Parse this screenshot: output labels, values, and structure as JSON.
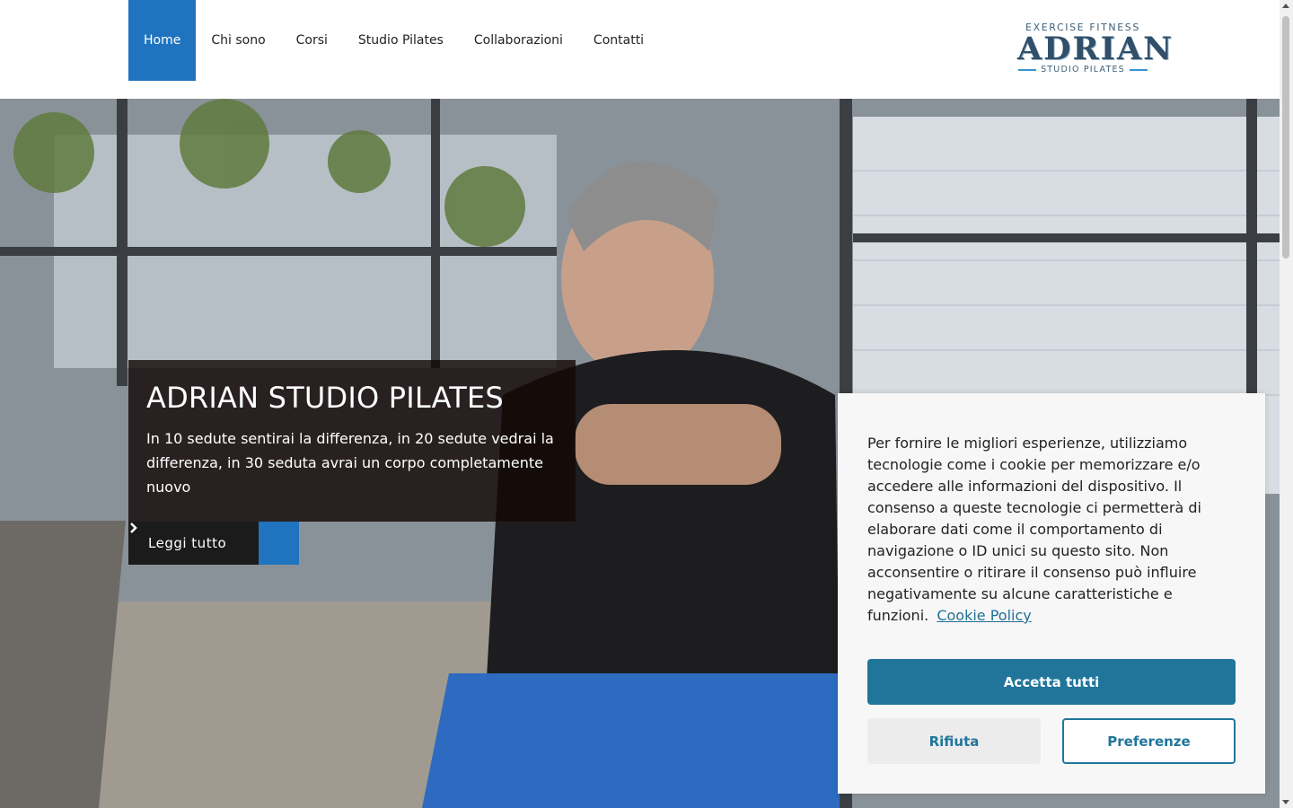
{
  "nav": {
    "items": [
      {
        "label": "Home",
        "active": true
      },
      {
        "label": "Chi sono",
        "active": false
      },
      {
        "label": "Corsi",
        "active": false
      },
      {
        "label": "Studio Pilates",
        "active": false
      },
      {
        "label": "Collaborazioni",
        "active": false
      },
      {
        "label": "Contatti",
        "active": false
      }
    ]
  },
  "logo": {
    "top": "EXERCISE FITNESS",
    "main": "ADRIAN",
    "sub": "STUDIO PILATES"
  },
  "hero": {
    "title": "ADRIAN STUDIO PILATES",
    "text": "In 10 sedute sentirai la differenza, in 20 sedute vedrai la differenza, in 30 seduta avrai un corpo completamente nuovo",
    "read_more": "Leggi tutto",
    "arrow_icon": "chevron-right-icon"
  },
  "cookie": {
    "text": "Per fornire le migliori esperienze, utilizziamo tecnologie come i cookie per memorizzare e/o accedere alle informazioni del dispositivo. Il consenso a queste tecnologie ci permetterà di elaborare dati come il comportamento di navigazione o ID unici su questo sito. Non acconsentire o ritirare il consenso può influire negativamente su alcune caratteristiche e funzioni.",
    "policy_link": "Cookie Policy",
    "accept": "Accetta tutti",
    "reject": "Rifiuta",
    "preferences": "Preferenze"
  },
  "colors": {
    "accent": "#2074bf",
    "cookie_button": "#21759b"
  }
}
